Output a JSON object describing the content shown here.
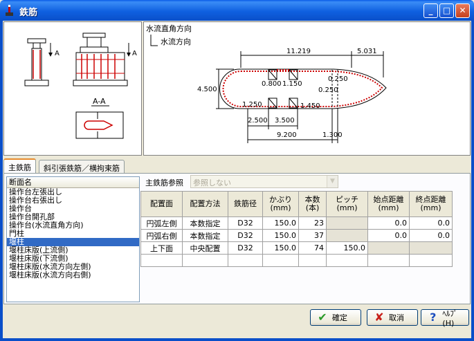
{
  "window": {
    "title": "鉄筋"
  },
  "left_diagram": {
    "arrow_label_1": "A",
    "arrow_label_2": "A",
    "section_label": "A-A"
  },
  "right_diagram": {
    "legend_vertical": "水流直角方向",
    "legend_horizontal": "水流方向",
    "dims": {
      "d_11219": "11.219",
      "d_5031": "5.031",
      "d_4500": "4.500",
      "d_0800": "0.800",
      "d_1150": "1.150",
      "d_0250a": "0.250",
      "d_0250b": "0.250",
      "d_1250": "1.250",
      "d_1450": "1.450",
      "d_2500": "2.500",
      "d_3500": "3.500",
      "d_9200": "9.200",
      "d_1300": "1.300"
    }
  },
  "tabs": [
    {
      "label": "主鉄筋",
      "active": true
    },
    {
      "label": "斜引張鉄筋／横拘束筋",
      "active": false
    }
  ],
  "section_list": {
    "header": "断面名",
    "items": [
      {
        "label": "操作台左張出し",
        "selected": false
      },
      {
        "label": "操作台右張出し",
        "selected": false
      },
      {
        "label": "操作台",
        "selected": false
      },
      {
        "label": "操作台開孔部",
        "selected": false
      },
      {
        "label": "操作台(水流直角方向)",
        "selected": false
      },
      {
        "label": "門柱",
        "selected": false
      },
      {
        "label": "堰柱",
        "selected": true
      },
      {
        "label": "堰柱床版(上流側)",
        "selected": false
      },
      {
        "label": "堰柱床版(下流側)",
        "selected": false
      },
      {
        "label": "堰柱床版(水流方向左側)",
        "selected": false
      },
      {
        "label": "堰柱床版(水流方向右側)",
        "selected": false
      }
    ]
  },
  "reference": {
    "label": "主鉄筋参照",
    "value": "参照しない"
  },
  "grid": {
    "headers": [
      [
        "配置面"
      ],
      [
        "配置方法"
      ],
      [
        "鉄筋径"
      ],
      [
        "かぶり",
        "(mm)"
      ],
      [
        "本数",
        "(本)"
      ],
      [
        "ピッチ",
        "(mm)"
      ],
      [
        "始点距離",
        "(mm)"
      ],
      [
        "終点距離",
        "(mm)"
      ]
    ],
    "rows": [
      [
        "円弧左側",
        "本数指定",
        "D32",
        "150.0",
        "23",
        "",
        "0.0",
        "0.0"
      ],
      [
        "円弧右側",
        "本数指定",
        "D32",
        "150.0",
        "37",
        "",
        "0.0",
        "0.0"
      ],
      [
        "上下面",
        "中央配置",
        "D32",
        "150.0",
        "74",
        "150.0",
        "",
        ""
      ],
      [
        "",
        "",
        "",
        "",
        "",
        "",
        "",
        ""
      ]
    ]
  },
  "buttons": {
    "ok": "確定",
    "cancel": "取消",
    "help": "ﾍﾙﾌﾟ(H)"
  },
  "colors": {
    "titlebar": "#0a5ce8",
    "selection": "#316ac5",
    "rebar": "#cc0000"
  }
}
